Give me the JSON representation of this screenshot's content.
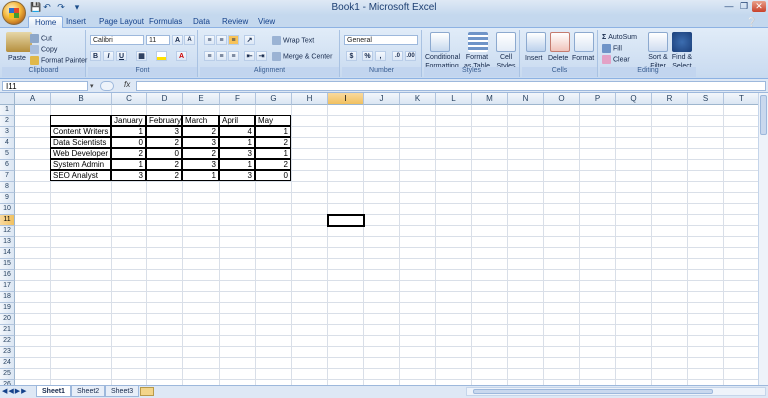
{
  "app": {
    "title": "Book1 - Microsoft Excel",
    "quick_access": [
      "save-icon",
      "undo-icon",
      "redo-icon",
      "customize-icon"
    ],
    "window_controls": [
      "minimize-icon",
      "restore-icon",
      "close-icon"
    ]
  },
  "tabs": [
    "Home",
    "Insert",
    "Page Layout",
    "Formulas",
    "Data",
    "Review",
    "View"
  ],
  "active_tab": "Home",
  "ribbon": {
    "clipboard": {
      "paste": "Paste",
      "cut": "Cut",
      "copy": "Copy",
      "format_painter": "Format Painter",
      "label": "Clipboard"
    },
    "font": {
      "name": "Calibri",
      "size": "11",
      "bold": "B",
      "italic": "I",
      "underline": "U",
      "grow": "A",
      "shrink": "A",
      "label": "Font"
    },
    "alignment": {
      "wrap": "Wrap Text",
      "merge": "Merge & Center",
      "label": "Alignment"
    },
    "number": {
      "format": "General",
      "currency": "$",
      "percent": "%",
      "comma": ",",
      "label": "Number"
    },
    "styles": {
      "conditional": "Conditional",
      "conditional2": "Formatting",
      "format_table": "Format",
      "format_table2": "as Table",
      "cell_styles": "Cell",
      "cell_styles2": "Styles",
      "label": "Styles"
    },
    "cells": {
      "insert": "Insert",
      "delete": "Delete",
      "format": "Format",
      "label": "Cells"
    },
    "editing": {
      "autosum": "AutoSum",
      "fill": "Fill",
      "clear": "Clear",
      "sort": "Sort &",
      "sort2": "Filter",
      "find": "Find &",
      "find2": "Select",
      "label": "Editing"
    }
  },
  "formula_bar": {
    "name_box": "I11",
    "fx": "fx",
    "value": ""
  },
  "grid": {
    "columns": [
      "A",
      "B",
      "C",
      "D",
      "E",
      "F",
      "G",
      "H",
      "I",
      "J",
      "K",
      "L",
      "M",
      "N",
      "O",
      "P",
      "Q",
      "R",
      "S",
      "T"
    ],
    "rows": [
      "1",
      "2",
      "3",
      "4",
      "5",
      "6",
      "7",
      "8",
      "9",
      "10",
      "11",
      "12",
      "13",
      "14",
      "15",
      "16",
      "17",
      "18",
      "19",
      "20",
      "21",
      "22",
      "23",
      "24",
      "25",
      "26"
    ],
    "selected_cell": "I11",
    "table": {
      "headers": [
        "",
        "January",
        "February",
        "March",
        "April",
        "May"
      ],
      "rows": [
        [
          "Content Writers",
          "1",
          "3",
          "2",
          "4",
          "1"
        ],
        [
          "Data Scientists",
          "0",
          "2",
          "3",
          "1",
          "2"
        ],
        [
          "Web Developer",
          "2",
          "0",
          "2",
          "3",
          "1"
        ],
        [
          "System Admin",
          "1",
          "2",
          "3",
          "1",
          "2"
        ],
        [
          "SEO Analyst",
          "3",
          "2",
          "1",
          "3",
          "0"
        ]
      ]
    }
  },
  "sheets": [
    "Sheet1",
    "Sheet2",
    "Sheet3"
  ],
  "active_sheet": "Sheet1"
}
